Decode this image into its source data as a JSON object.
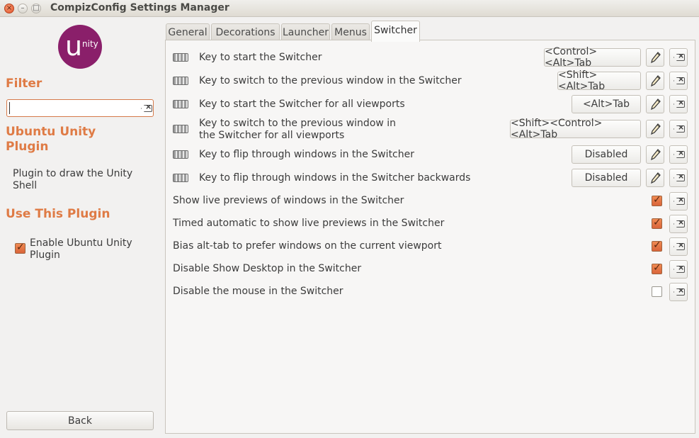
{
  "window": {
    "title": "CompizConfig Settings Manager"
  },
  "logo": {
    "big": "u",
    "small": "nity"
  },
  "left": {
    "filter_heading": "Filter",
    "filter_value": "",
    "plugin_heading": "Ubuntu Unity Plugin",
    "plugin_description": "Plugin to draw the Unity Shell",
    "use_heading": "Use This Plugin",
    "enable_label": "Enable Ubuntu Unity Plugin",
    "enable_checked": true,
    "back_label": "Back"
  },
  "tabs": [
    "General",
    "Decorations",
    "Launcher",
    "Menus",
    "Switcher"
  ],
  "active_tab": "Switcher",
  "key_settings": [
    {
      "label": "Key to start the Switcher",
      "value": "<Control><Alt>Tab"
    },
    {
      "label": "Key to switch to the previous window in the Switcher",
      "value": "<Shift><Alt>Tab"
    },
    {
      "label": "Key to start the Switcher for all viewports",
      "value": "<Alt>Tab"
    },
    {
      "label_line1": "Key to switch to the previous window in",
      "label_line2": "the Switcher for all viewports",
      "value": "<Shift><Control><Alt>Tab"
    },
    {
      "label": "Key to flip through windows in the Switcher",
      "value": "Disabled"
    },
    {
      "label": "Key to flip through windows in the Switcher backwards",
      "value": "Disabled"
    }
  ],
  "bool_settings": [
    {
      "label": "Show live previews of windows in the Switcher",
      "checked": true
    },
    {
      "label": "Timed automatic to show live previews in the Switcher",
      "checked": true
    },
    {
      "label": "Bias alt-tab to prefer windows on the current viewport",
      "checked": true
    },
    {
      "label": "Disable Show Desktop in the Switcher",
      "checked": true
    },
    {
      "label": "Disable the mouse in the Switcher",
      "checked": false
    }
  ],
  "colors": {
    "accent": "#df7b45",
    "logo": "#8a1f6a"
  }
}
